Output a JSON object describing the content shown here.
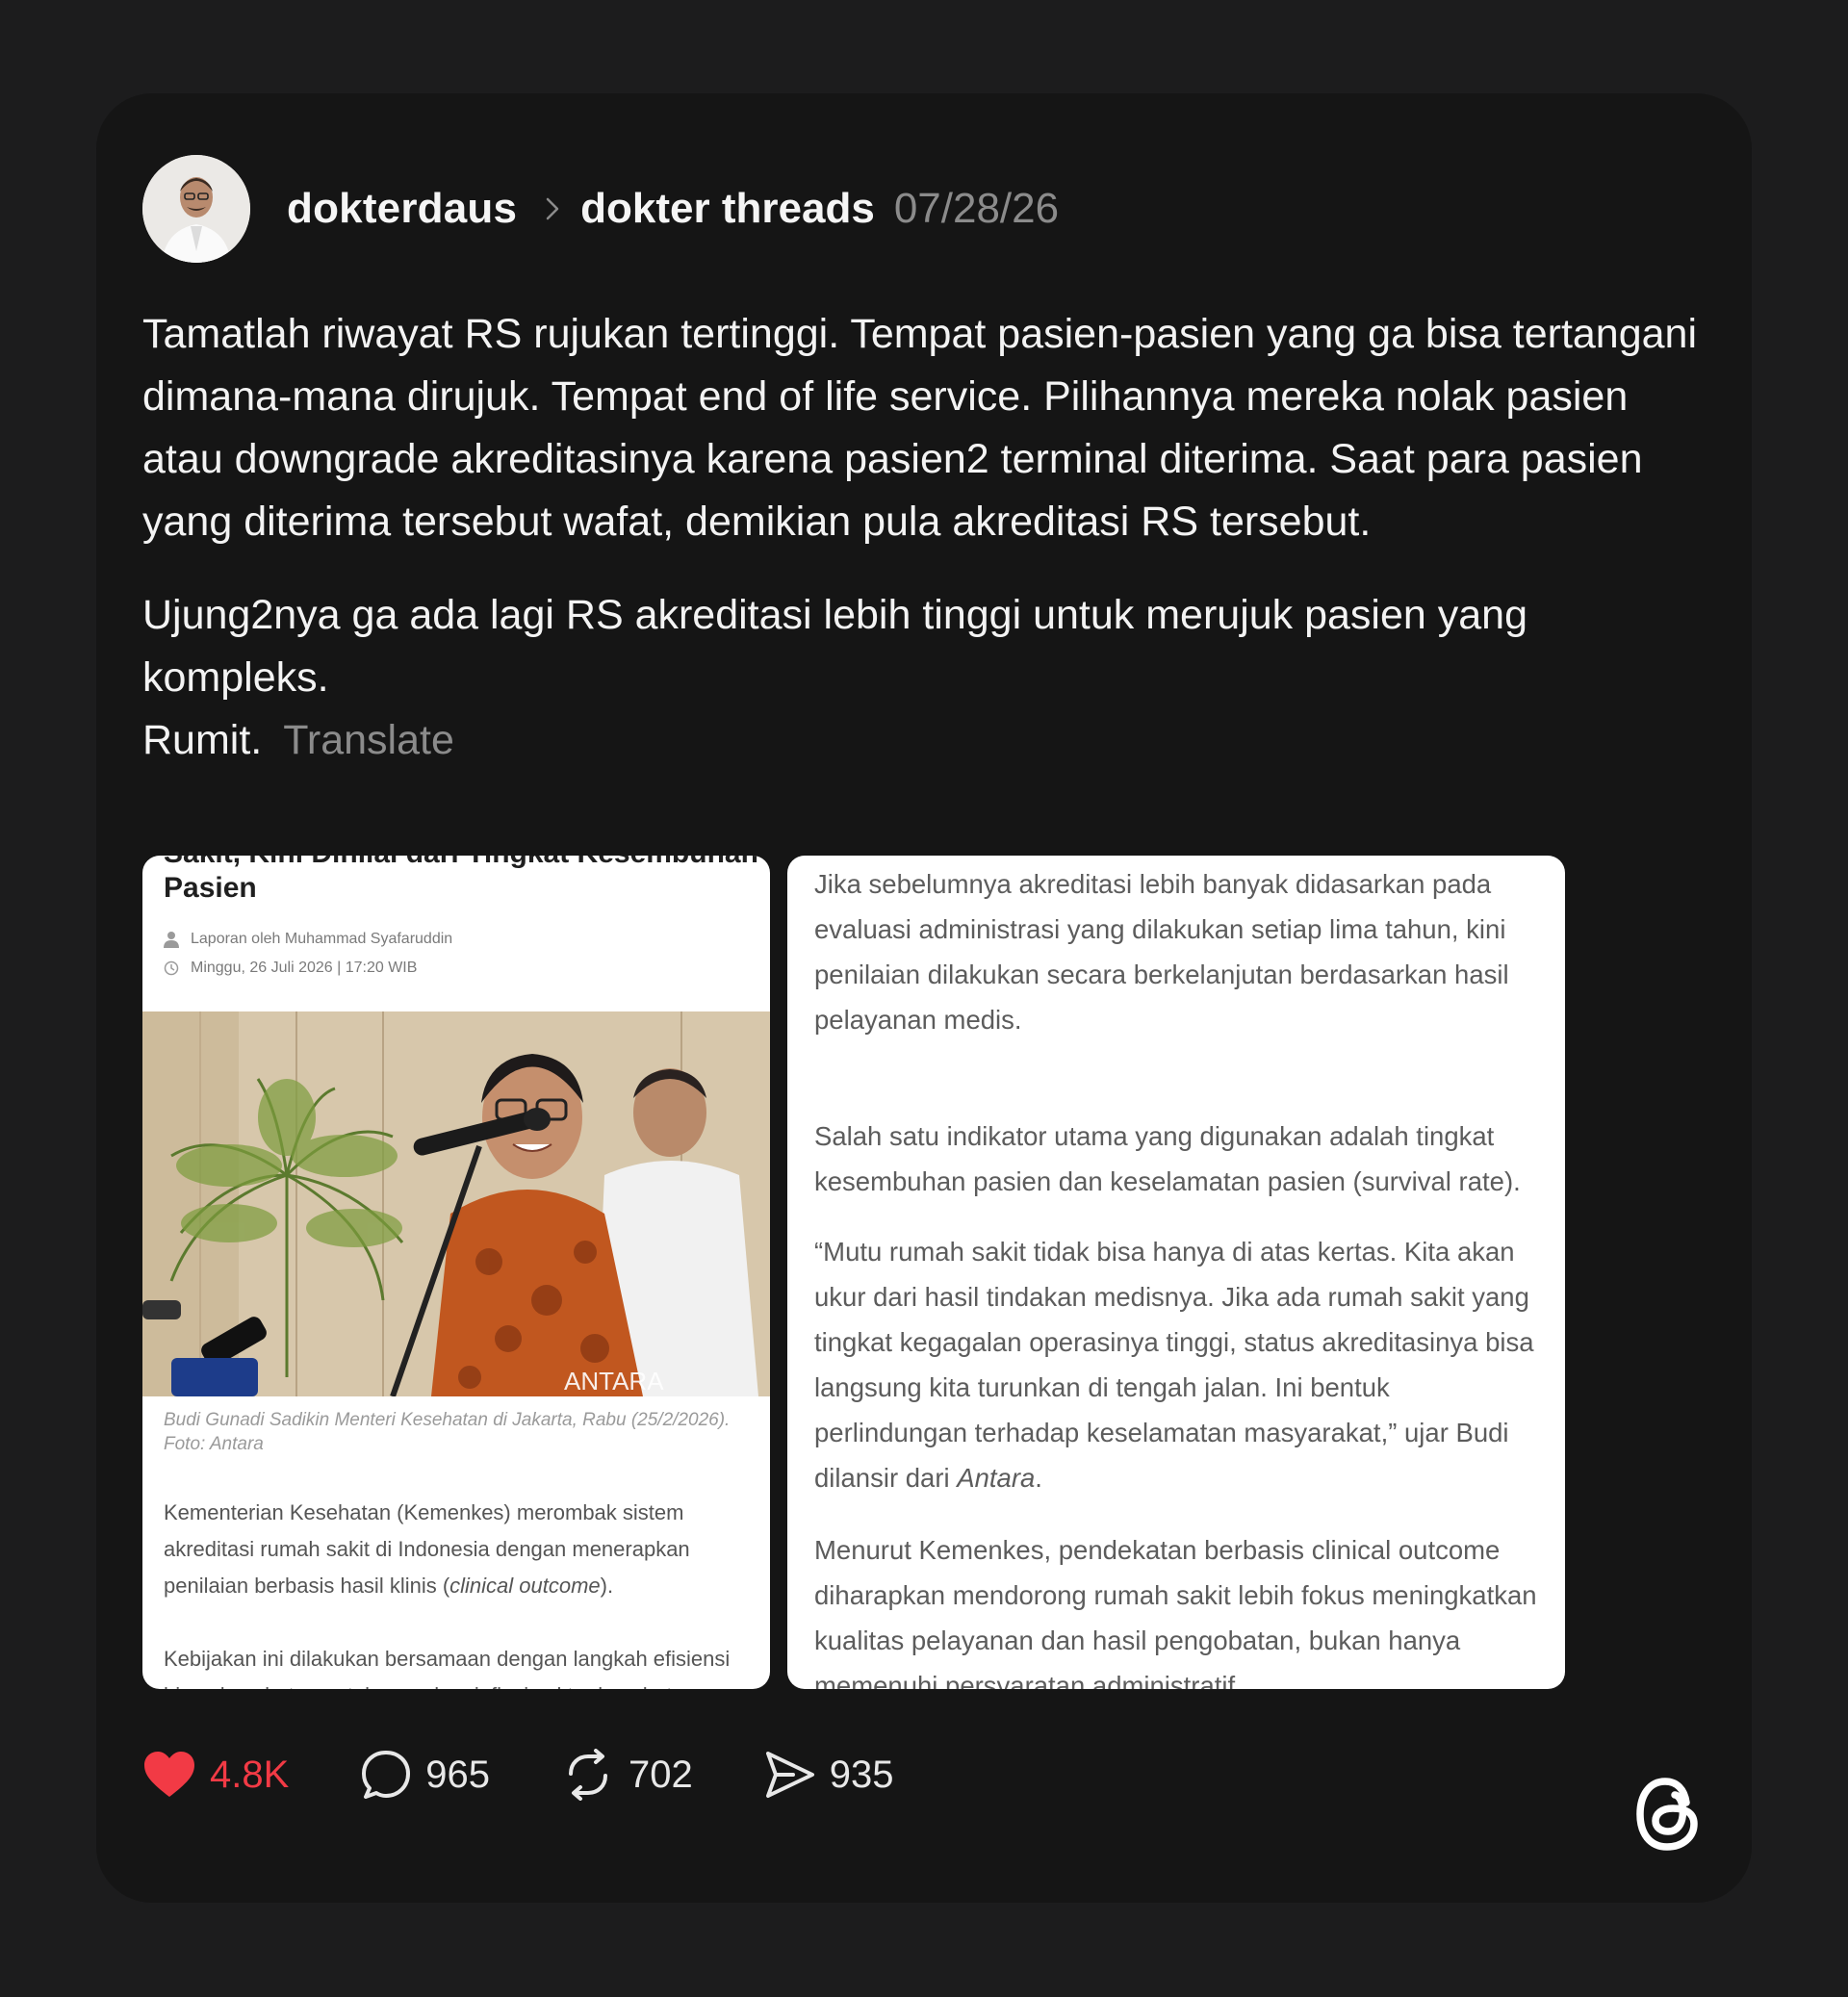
{
  "post": {
    "username": "dokterdaus",
    "topic": "dokter threads",
    "date": "07/28/26",
    "paragraph1": "Tamatlah riwayat RS rujukan tertinggi. Tempat pasien-pasien yang ga bisa tertangani dimana-mana dirujuk. Tempat end of life service. Pilihannya mereka nolak pasien atau downgrade akreditasinya karena pasien2 terminal diterima. Saat para pasien yang diterima tersebut wafat, demikian pula akreditasi RS tersebut.",
    "paragraph2": "Ujung2nya ga ada lagi RS akreditasi lebih tinggi untuk merujuk pasien yang kompleks.",
    "paragraph3": "Rumit.",
    "translate_label": "Translate"
  },
  "article_left": {
    "headline_line1": "Sakit, Kini Dinilai dari Tingkat Kesembuhan",
    "headline_line2": "Pasien",
    "author": "Laporan oleh Muhammad Syafaruddin",
    "datetime": "Minggu, 26 Juli 2026  | 17:20 WIB",
    "watermark": "ANTARA",
    "caption": "Budi Gunadi Sadikin Menteri Kesehatan di Jakarta, Rabu (25/2/2026). Foto: Antara",
    "lead_before": "Kementerian Kesehatan (Kemenkes) merombak sistem akreditasi rumah sakit di Indonesia dengan menerapkan penilaian berbasis hasil klinis (",
    "lead_italic": "clinical outcome",
    "lead_after": ").",
    "para2": "Kebijakan ini dilakukan bersamaan dengan langkah efisiensi biaya kesehatan untuk menekan inflasi sektor kesehatan"
  },
  "article_right": {
    "para1": "Jika sebelumnya akreditasi lebih banyak didasarkan pada evaluasi administrasi yang dilakukan setiap lima tahun, kini penilaian dilakukan secara berkelanjutan berdasarkan hasil pelayanan medis.",
    "para2": "Salah satu indikator utama yang digunakan adalah tingkat kesembuhan pasien dan keselamatan pasien (survival rate).",
    "para3": "“Mutu rumah sakit tidak bisa hanya di atas kertas. Kita akan ukur dari hasil tindakan medisnya. Jika ada rumah sakit yang tingkat kegagalan operasinya tinggi, status akreditasinya bisa langsung kita turunkan di tengah jalan. Ini bentuk perlindungan terhadap keselamatan masyarakat,” ujar Budi dilansir dari",
    "para3_italic": "Antara",
    "para3_end": ".",
    "para4": "Menurut Kemenkes, pendekatan berbasis clinical outcome diharapkan mendorong rumah sakit lebih fokus meningkatkan kualitas pelayanan dan hasil pengobatan, bukan hanya memenuhi persyaratan administratif."
  },
  "actions": {
    "likes": "4.8K",
    "replies": "965",
    "reposts": "702",
    "shares": "935"
  },
  "colors": {
    "background": "#1c1c1d",
    "card": "#151515",
    "like_red": "#f23a45",
    "muted": "#8b8b8b"
  },
  "icons": [
    "heart-icon",
    "comment-icon",
    "repost-icon",
    "share-icon",
    "threads-logo-icon",
    "chevron-right-icon",
    "person-icon",
    "clock-icon"
  ]
}
